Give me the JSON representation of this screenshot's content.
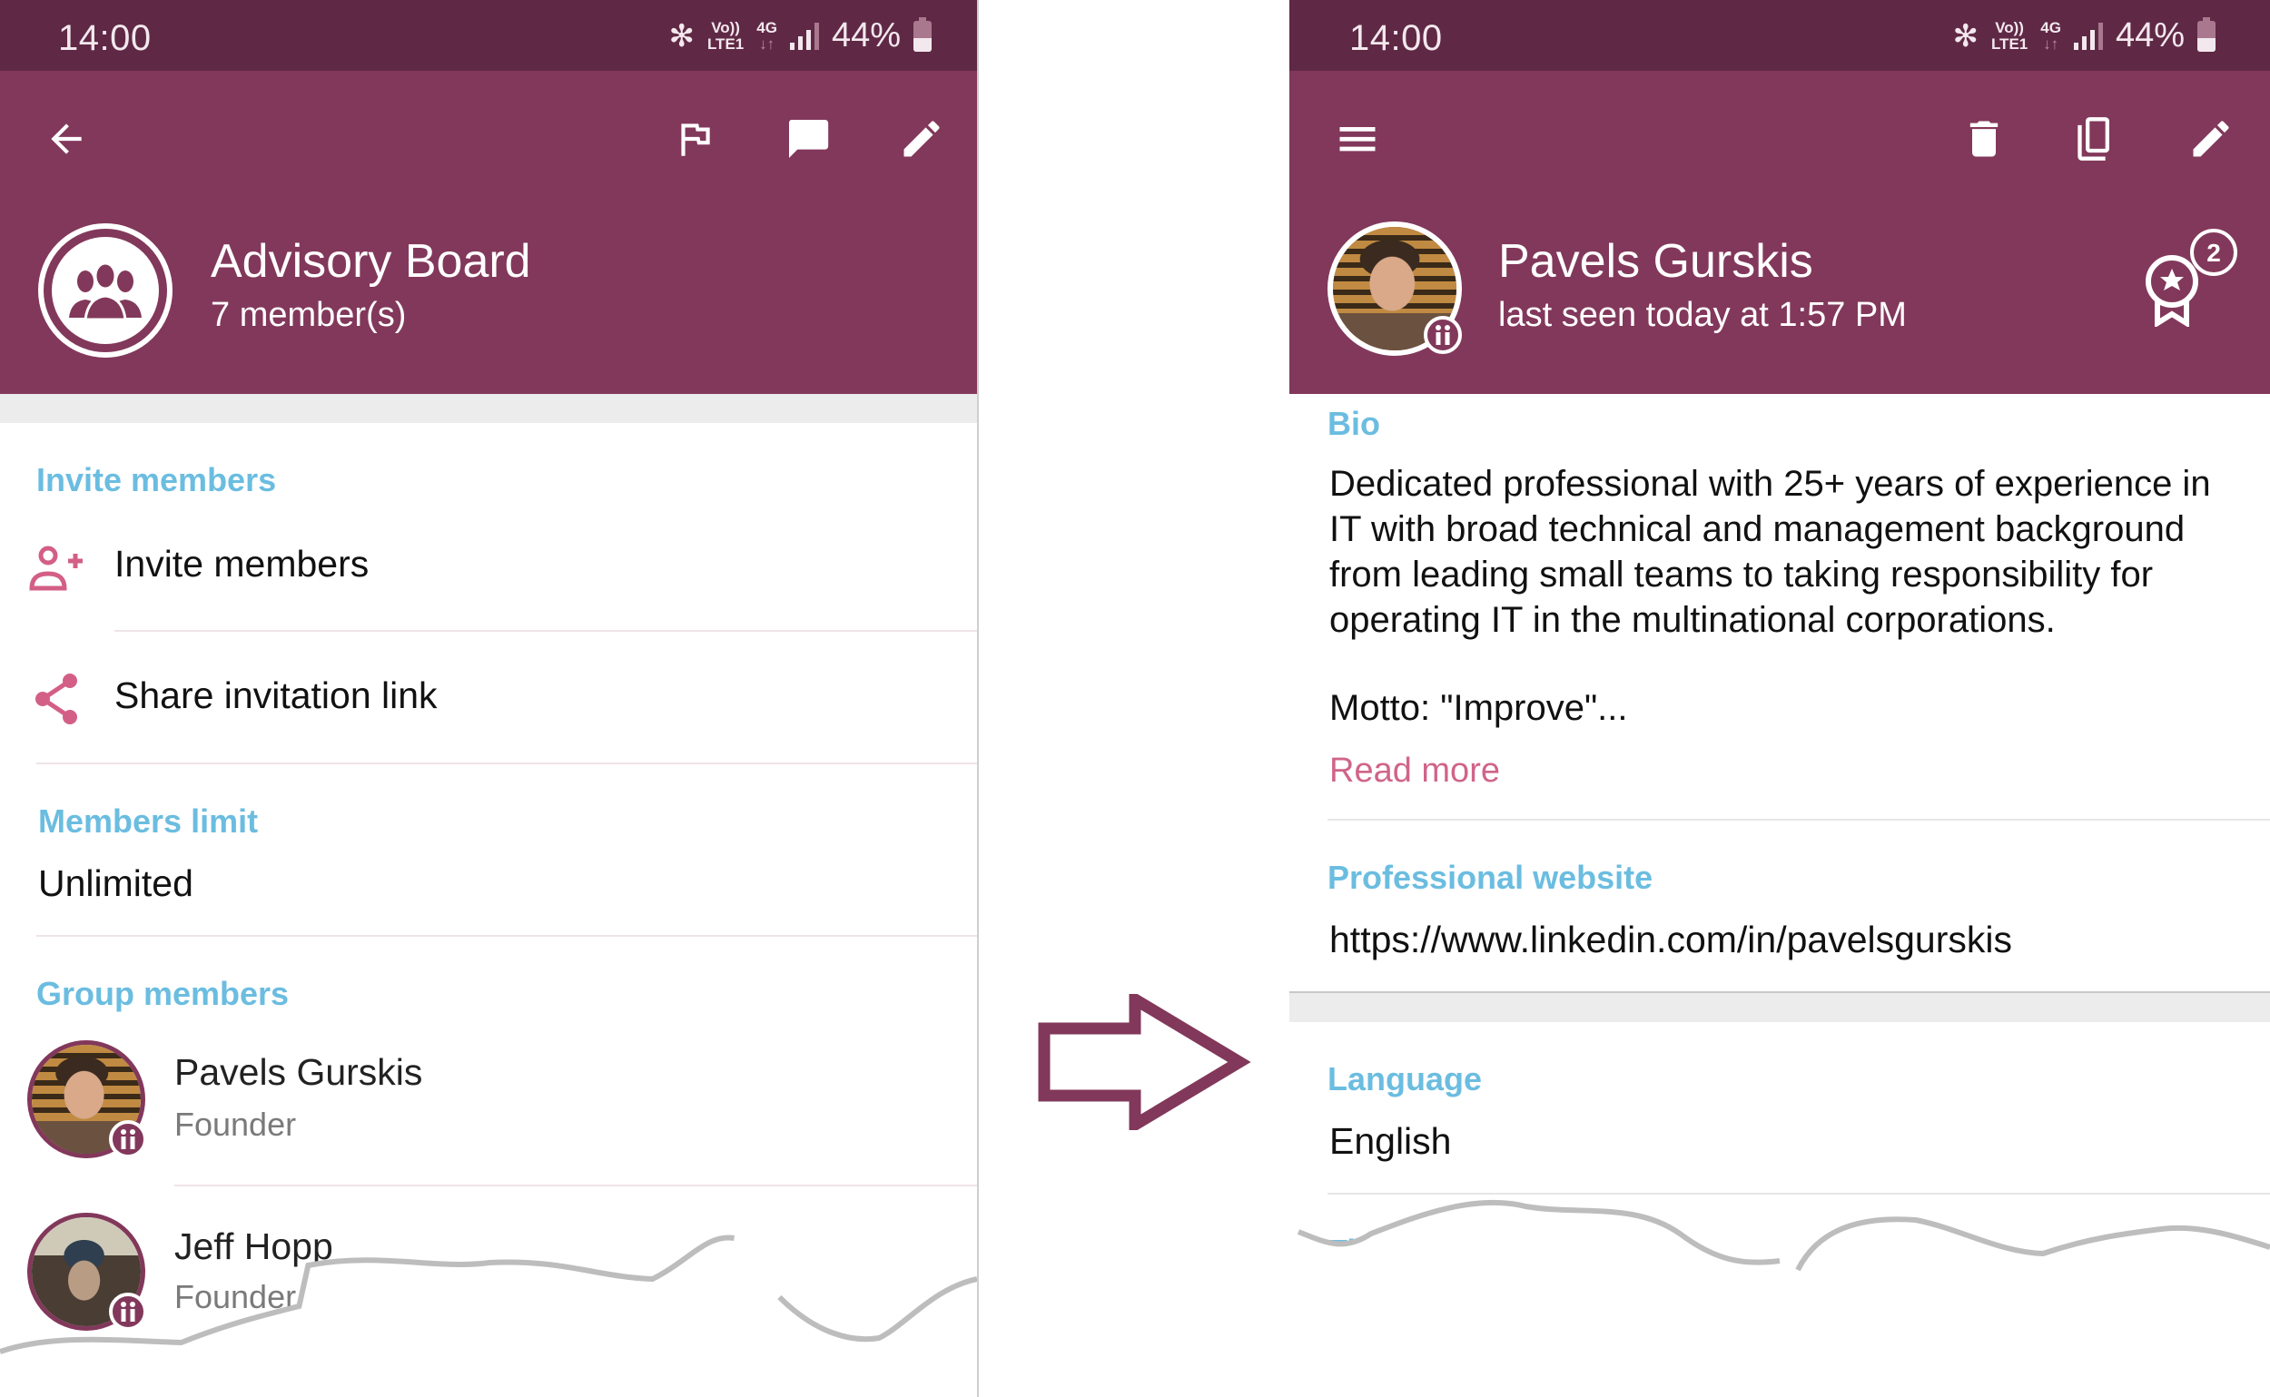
{
  "left_screen": {
    "status_bar": {
      "time": "14:00",
      "icons": [
        "bluetooth-icon",
        "volte-icon",
        "4g-icon",
        "signal-icon",
        "battery-icon"
      ],
      "volte_top": "Vo))",
      "volte_bottom": "LTE1",
      "net_top": "4G",
      "net_bottom": "↓↑",
      "battery_percent_label": "44%",
      "battery_level": 0.44
    },
    "toolbar": {
      "back_icon": "arrow-left-icon",
      "actions": [
        "flag-icon",
        "chat-bubble-icon",
        "pencil-icon"
      ]
    },
    "header": {
      "title": "Advisory Board",
      "subtitle": "7 member(s)",
      "avatar_icon": "group-icon"
    },
    "invite_section": {
      "label": "Invite members",
      "items": [
        {
          "label": "Invite members",
          "icon": "person-add-icon"
        },
        {
          "label": "Share invitation link",
          "icon": "share-icon"
        }
      ]
    },
    "limit_section": {
      "label": "Members limit",
      "value": "Unlimited"
    },
    "members_section": {
      "label": "Group members",
      "members": [
        {
          "name": "Pavels Gurskis",
          "role": "Founder"
        },
        {
          "name": "Jeff Hopp",
          "role": "Founder"
        }
      ]
    }
  },
  "right_screen": {
    "status_bar": {
      "time": "14:00",
      "volte_top": "Vo))",
      "volte_bottom": "LTE1",
      "net_top": "4G",
      "net_bottom": "↓↑",
      "battery_percent_label": "44%",
      "battery_level": 0.44
    },
    "toolbar": {
      "menu_icon": "hamburger-menu-icon",
      "actions": [
        "trash-icon",
        "copy-icon",
        "pencil-icon"
      ]
    },
    "header": {
      "name": "Pavels Gurskis",
      "status": "last seen today at 1:57 PM",
      "award_icon": "award-ribbon-icon",
      "award_count": "2"
    },
    "bio": {
      "label": "Bio",
      "text": "Dedicated professional with 25+ years of experience in IT with broad technical and management background from leading small teams to taking responsibility for operating IT in the multinational corporations.",
      "motto": "Motto: \"Improve\"...",
      "read_more": "Read more"
    },
    "website": {
      "label": "Professional website",
      "value": "https://www.linkedin.com/in/pavelsgurskis"
    },
    "language": {
      "label": "Language",
      "value": "English"
    },
    "timezone": {
      "label": "Time zone"
    }
  },
  "colors": {
    "status_bar": "#5f2945",
    "app_bar": "#82385b",
    "section_label": "#6bbde0",
    "accent_pink": "#d0648a",
    "arrow": "#82385b"
  }
}
